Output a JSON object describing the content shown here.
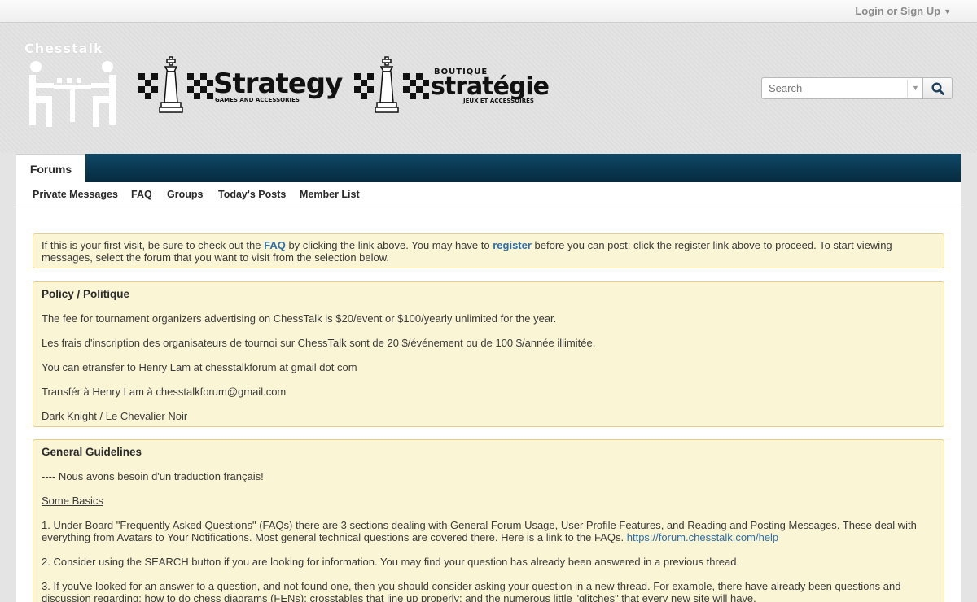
{
  "topbar": {
    "login_label": "Login or Sign Up",
    "login_arrow": "▼"
  },
  "header": {
    "logo_text": "Chesstalk",
    "sponsor1": {
      "name": "Strategy",
      "tagline": "GAMES AND ACCESSORIES"
    },
    "sponsor2": {
      "top": "BOUTIQUE",
      "name": "stratégie",
      "tagline": "JEUX ET ACCESSOIRES"
    }
  },
  "search": {
    "placeholder": "Search",
    "dropdown_icon": "▼"
  },
  "nav": {
    "active_tab": "Forums",
    "subnav": [
      "Private Messages",
      "FAQ",
      "Groups",
      "Today's Posts",
      "Member List"
    ]
  },
  "welcome": {
    "text1": "If this is your first visit, be sure to check out the ",
    "faq_link": "FAQ",
    "text2": " by clicking the link above. You may have to ",
    "register_link": "register",
    "text3": " before you can post: click the register link above to proceed. To start viewing messages, select the forum that you want to visit from the selection below."
  },
  "policy": {
    "title": "Policy / Politique",
    "paragraphs": [
      "The fee for tournament organizers advertising on ChessTalk is $20/event or $100/yearly unlimited for the year.",
      "Les frais d'inscription des organisateurs de tournoi sur ChessTalk sont de 20 $/événement ou de 100 $/année illimitée.",
      "You can etransfer to Henry Lam at chesstalkforum at gmail dot com",
      "Transfér à Henry Lam à chesstalkforum@gmail.com",
      "Dark Knight / Le Chevalier Noir"
    ]
  },
  "guidelines": {
    "title": "General Guidelines",
    "p0": "---- Nous avons besoin d'un traduction français!",
    "basics": "Some Basics",
    "p1": "1. Under Board \"Frequently Asked Questions\" (FAQs) there are 3 sections dealing with General Forum Usage, User Profile Features, and Reading and Posting Messages. These deal with everything from Avatars to Your Notifications. Most general technical questions are covered there. Here is a link to the FAQs. ",
    "p1_link": "https://forum.chesstalk.com/help",
    "p2": "2. Consider using the SEARCH button if you are looking for information. You may find your question has already been answered in a previous thread.",
    "p3": "3. If you've looked for an answer to a question, and not found one, then you should consider asking your question in a new thread. For example, there have already been questions and discussion regarding: how to do chess diagrams (FENs); crosstables that line up properly; and the numerous little \"glitches\" that every new site will have."
  }
}
